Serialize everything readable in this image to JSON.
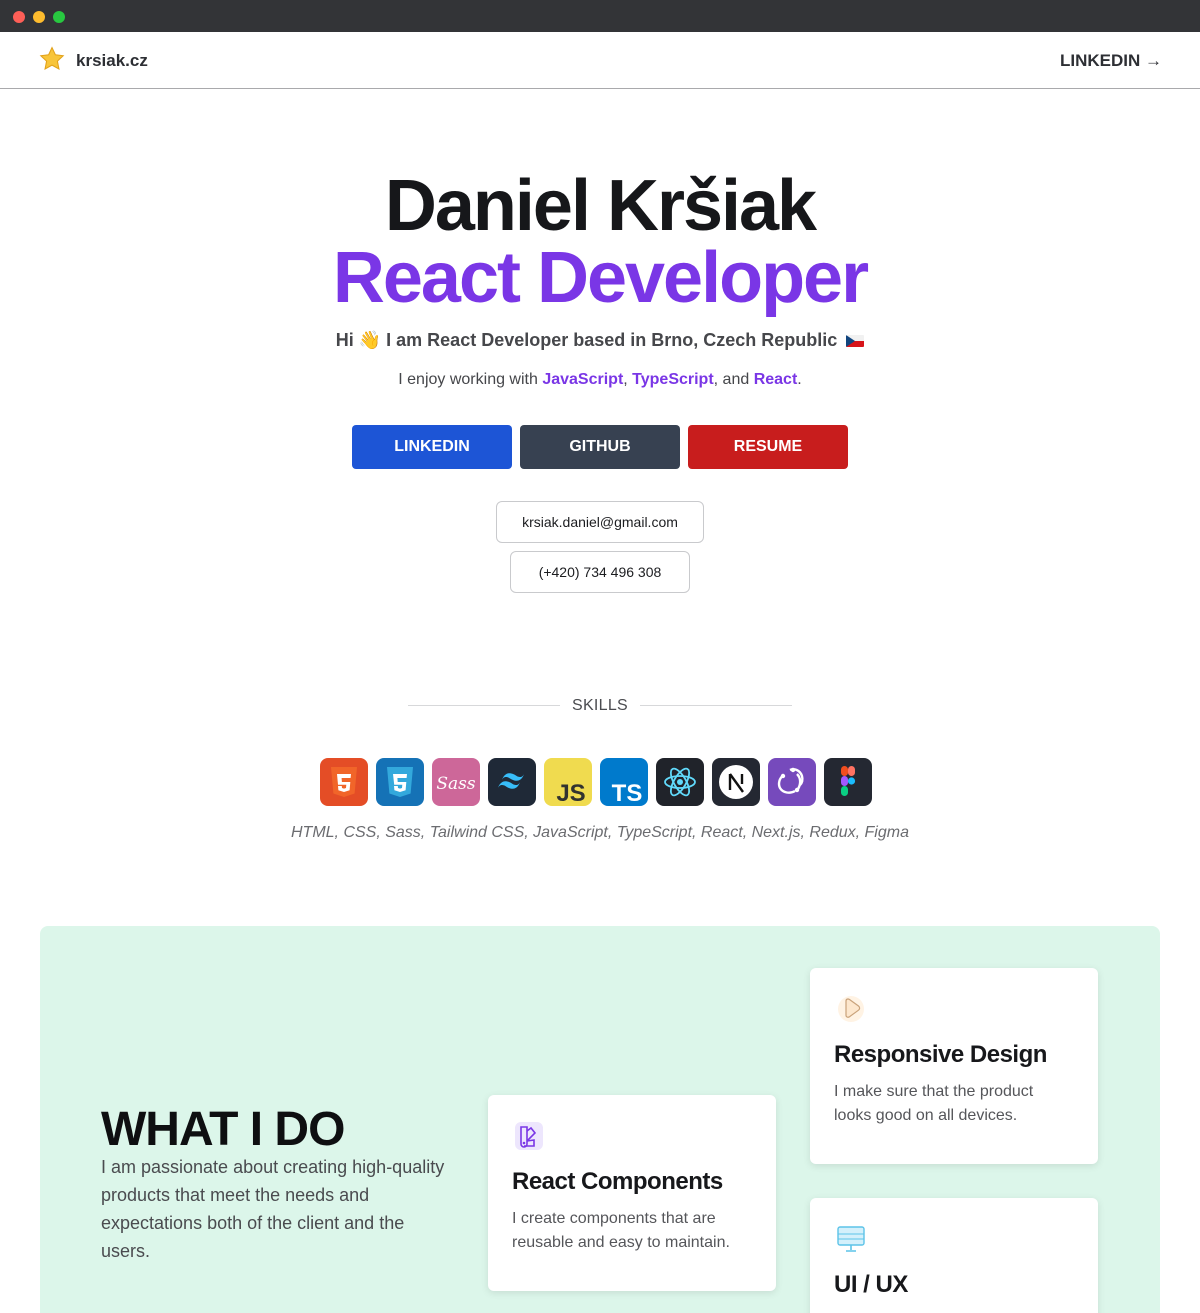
{
  "nav": {
    "brand": "krsiak.cz",
    "link_label": "LINKEDIN →"
  },
  "hero": {
    "name": "Daniel Kršiak",
    "role": "React Developer",
    "intro_hi": "Hi",
    "intro_rest": "I am React Developer based in Brno, Czech Republic",
    "tech_prefix": "I enjoy working with ",
    "tech_js": "JavaScript",
    "tech_sep1": ", ",
    "tech_ts": "TypeScript",
    "tech_sep2": ", and ",
    "tech_react": "React",
    "tech_suffix": ".",
    "buttons": {
      "linkedin": "LINKEDIN",
      "github": "GITHUB",
      "resume": "RESUME"
    },
    "email": "krsiak.daniel@gmail.com",
    "phone": "(+420) 734 496 308"
  },
  "skills": {
    "title": "SKILLS",
    "icons": [
      {
        "name": "html5-icon",
        "bg": "#e44d26",
        "label": "5"
      },
      {
        "name": "css3-icon",
        "bg": "#1572b6",
        "label": "3"
      },
      {
        "name": "sass-icon",
        "bg": "#cd6799",
        "label": "Sass"
      },
      {
        "name": "tailwind-icon",
        "bg": "#1f2937",
        "label": ""
      },
      {
        "name": "javascript-icon",
        "bg": "#f0db4f",
        "label": "JS"
      },
      {
        "name": "typescript-icon",
        "bg": "#007acc",
        "label": "TS"
      },
      {
        "name": "react-icon",
        "bg": "#20232a",
        "label": ""
      },
      {
        "name": "nextjs-icon",
        "bg": "#242832",
        "label": ""
      },
      {
        "name": "redux-icon",
        "bg": "#764abc",
        "label": ""
      },
      {
        "name": "figma-icon",
        "bg": "#242832",
        "label": ""
      }
    ],
    "list": "HTML, CSS, Sass, Tailwind CSS, JavaScript, TypeScript, React, Next.js, Redux, Figma"
  },
  "what_i_do": {
    "title": "WHAT I DO",
    "text": "I am passionate about creating high-quality products that meet the needs and expectations both of the client and the users.",
    "cards": [
      {
        "title": "React Components",
        "text": "I create components that are reusable and easy to maintain."
      },
      {
        "title": "Responsive Design",
        "text": "I make sure that the product looks good on all devices."
      },
      {
        "title": "UI / UX",
        "text": ""
      }
    ]
  }
}
